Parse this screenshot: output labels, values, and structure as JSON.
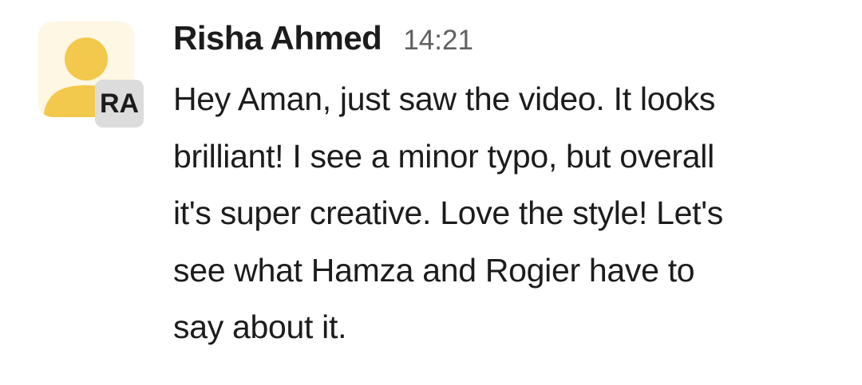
{
  "message": {
    "sender": "Risha Ahmed",
    "timestamp": "14:21",
    "avatar_initials": "RA",
    "avatar_icon": "user-silhouette-icon",
    "body_lines": [
      "Hey Aman, just saw the video. It looks",
      "brilliant! I see a minor typo, but overall",
      "it's super creative. Love the style! Let's",
      "see what Hamza and Rogier have to",
      "say about it."
    ]
  },
  "colors": {
    "avatar_bg": "#fdf7e3",
    "avatar_figure": "#f2c94c",
    "badge_bg": "#dcdcdc",
    "text": "#1d1c1d",
    "timestamp": "#616061"
  }
}
